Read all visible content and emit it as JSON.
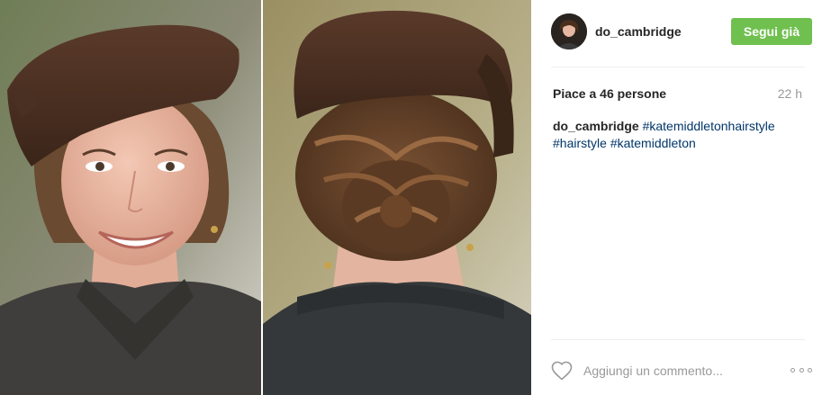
{
  "post": {
    "username": "do_cambridge",
    "follow_label": "Segui già",
    "likes": "Piace a 46 persone",
    "time": "22 h",
    "caption_user": "do_cambridge",
    "hashtags": [
      "#katemiddletonhairstyle",
      "#hairstyle",
      "#katemiddleton"
    ],
    "comment_placeholder": "Aggiungi un commento...",
    "follow_color": "#70c050"
  },
  "icons": {
    "like": "heart-icon",
    "more": "more-options-icon"
  }
}
